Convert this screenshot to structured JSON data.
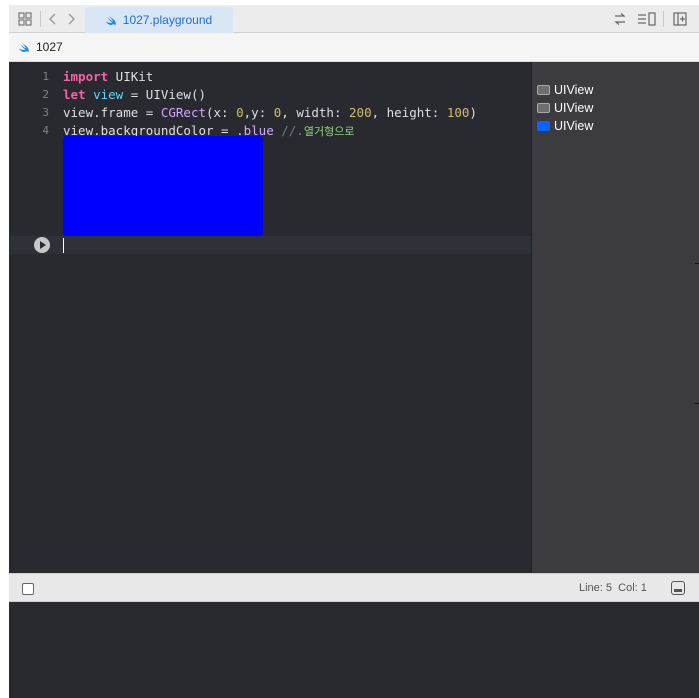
{
  "window": {
    "tab_title": "1027.playground"
  },
  "jumpbar": {
    "crumb": "1027"
  },
  "editor": {
    "lines": [
      {
        "num": "1",
        "t1": "import",
        "t2": " UIKit"
      },
      {
        "num": "2",
        "t1": "let",
        "t2": " ",
        "t3": "view",
        "t4": " = UIView()"
      },
      {
        "num": "3",
        "t1": "view.frame = ",
        "t2": "CGRect",
        "t3": "(x: ",
        "t4": "0",
        "t5": ",y: ",
        "t6": "0",
        "t7": ", width: ",
        "t8": "200",
        "t9": ", height: ",
        "t10": "100",
        "t11": ")"
      },
      {
        "num": "4",
        "t1": "view.backgroundColor = ",
        "t2": ".blue",
        "t3": " //.",
        "t4": "열거형으로"
      }
    ],
    "preview_color": "#0000ff"
  },
  "results": [
    {
      "label": "UIView",
      "swatch": "#6e6e6e"
    },
    {
      "label": "UIView",
      "swatch": "#6e6e6e"
    },
    {
      "label": "UIView",
      "swatch": "#0a64ff"
    }
  ],
  "status": {
    "position": "Line: 5  Col: 1"
  },
  "icons": {
    "grid": "grid-icon",
    "back": "chevron-left-icon",
    "forward": "chevron-right-icon",
    "swap": "swap-arrows-icon",
    "lines": "list-lines-icon",
    "add_editor": "add-editor-icon",
    "swift": "swift-icon",
    "play": "play-icon",
    "console": "console-icon"
  }
}
